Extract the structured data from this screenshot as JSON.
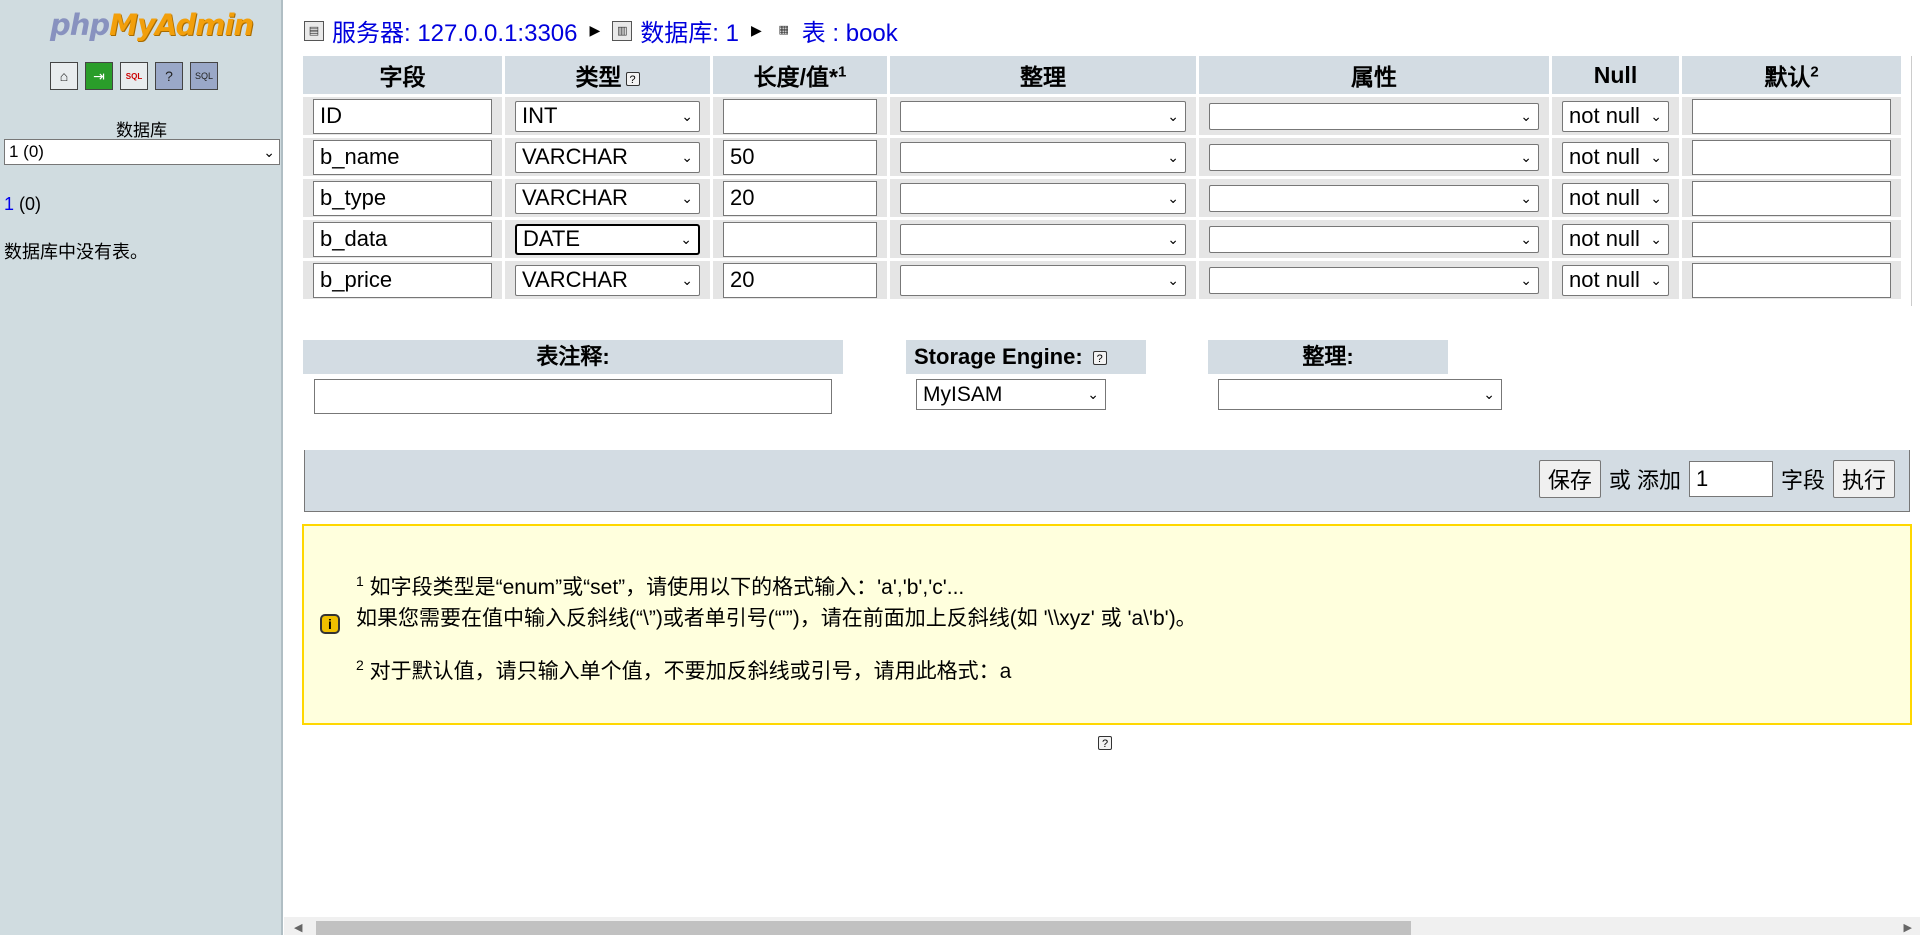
{
  "sidebar": {
    "logo_php": "php",
    "logo_myadmin": "MyAdmin",
    "icons": [
      "home-icon",
      "exit-icon",
      "sql-icon",
      "help-icon",
      "docs-icon"
    ],
    "db_heading": "数据库",
    "db_select": "1 (0)",
    "db_link": "1",
    "db_link_count": "(0)",
    "no_tables": "数据库中没有表。"
  },
  "breadcrumb": {
    "server": "服务器: 127.0.0.1:3306",
    "database": "数据库: 1",
    "table": "表 : book"
  },
  "field_table": {
    "headers": {
      "field": "字段",
      "type": "类型",
      "length": "长度/值*",
      "length_sup": "1",
      "collation": "整理",
      "attributes": "属性",
      "null": "Null",
      "default": "默认",
      "default_sup": "2"
    },
    "rows": [
      {
        "name": "ID",
        "type": "INT",
        "length": "",
        "collation": "",
        "attribute": "",
        "null": "not null",
        "default": ""
      },
      {
        "name": "b_name",
        "type": "VARCHAR",
        "length": "50",
        "collation": "",
        "attribute": "",
        "null": "not null",
        "default": ""
      },
      {
        "name": "b_type",
        "type": "VARCHAR",
        "length": "20",
        "collation": "",
        "attribute": "",
        "null": "not null",
        "default": ""
      },
      {
        "name": "b_data",
        "type": "DATE",
        "length": "",
        "collation": "",
        "attribute": "",
        "null": "not null",
        "default": ""
      },
      {
        "name": "b_price",
        "type": "VARCHAR",
        "length": "20",
        "collation": "",
        "attribute": "",
        "null": "not null",
        "default": ""
      }
    ]
  },
  "table_options": {
    "comment_label": "表注释:",
    "comment_value": "",
    "engine_label": "Storage Engine:",
    "engine_value": "MyISAM",
    "collation_label": "整理:",
    "collation_value": ""
  },
  "save_bar": {
    "save_label": "保存",
    "or_add": "或 添加",
    "add_count": "1",
    "fields_label": "字段",
    "go_label": "执行"
  },
  "notice": {
    "sup1": "1",
    "line1": "如字段类型是“enum”或“set”，请使用以下的格式输入：'a','b','c'...",
    "line2": "如果您需要在值中输入反斜线(“\\”)或者单引号(“'”)，请在前面加上反斜线(如 '\\\\xyz' 或 'a\\'b')。",
    "sup2": "2",
    "line3": "对于默认值，请只输入单个值，不要加反斜线或引号，请用此格式：a"
  }
}
